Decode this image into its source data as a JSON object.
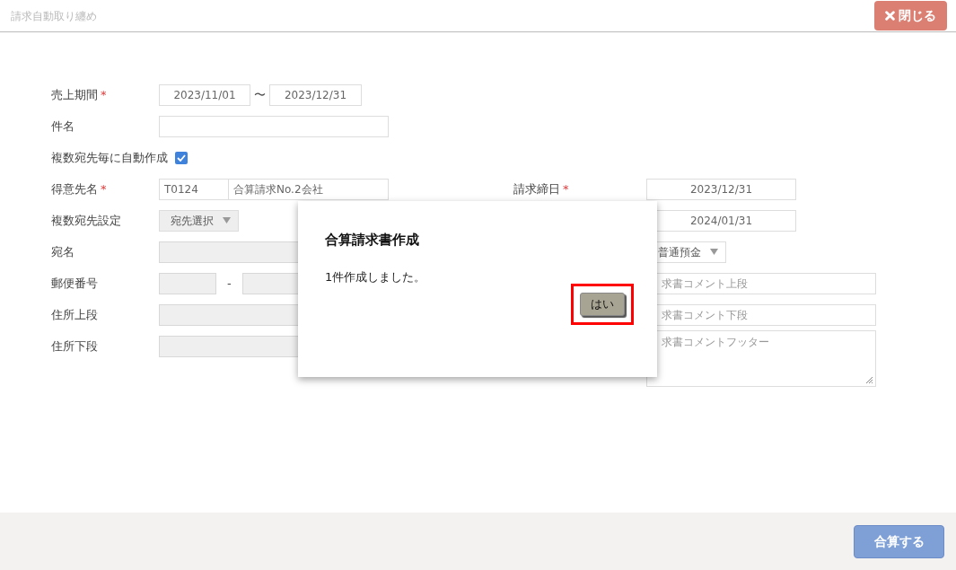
{
  "header": {
    "title": "請求自動取り纏め",
    "close_button": {
      "label": "閉じる"
    }
  },
  "left_rows": [
    {
      "kind": "date_range",
      "label": "売上期間",
      "required_mark": "*",
      "from": "2023/11/01",
      "separator": "〜",
      "to": "2023/12/31"
    },
    {
      "kind": "text",
      "label": "件名",
      "disabled": false
    },
    {
      "kind": "checkbox",
      "label": "複数宛先毎に自動作成",
      "checked": true
    },
    {
      "kind": "customer",
      "label": "得意先名",
      "required_mark": "*",
      "code": "T0124",
      "name": "合算請求No.2会社"
    },
    {
      "kind": "select",
      "label": "複数宛先設定",
      "value": "宛先選択"
    },
    {
      "kind": "text",
      "label": "宛名",
      "disabled": true
    },
    {
      "kind": "postal",
      "label": "郵便番号",
      "separator": "-",
      "disabled": true
    },
    {
      "kind": "text",
      "label": "住所上段",
      "disabled": true
    },
    {
      "kind": "text",
      "label": "住所下段",
      "disabled": true
    }
  ],
  "right_rows": [
    {
      "kind": "date",
      "label": "請求締日",
      "required_mark": "*",
      "value": "2023/12/31"
    },
    {
      "kind": "date",
      "value": "2024/01/31"
    },
    {
      "kind": "select",
      "value": "普通預金"
    },
    {
      "kind": "text",
      "placeholder": "求書コメント上段"
    },
    {
      "kind": "text",
      "placeholder": "求書コメント下段"
    },
    {
      "kind": "textarea",
      "placeholder": "求書コメントフッター"
    }
  ],
  "dialog": {
    "title": "合算請求書作成",
    "message": "1件作成しました。",
    "button": {
      "label": "はい",
      "highlighted": true
    }
  },
  "footer": {
    "button": {
      "label": "合算する"
    }
  }
}
